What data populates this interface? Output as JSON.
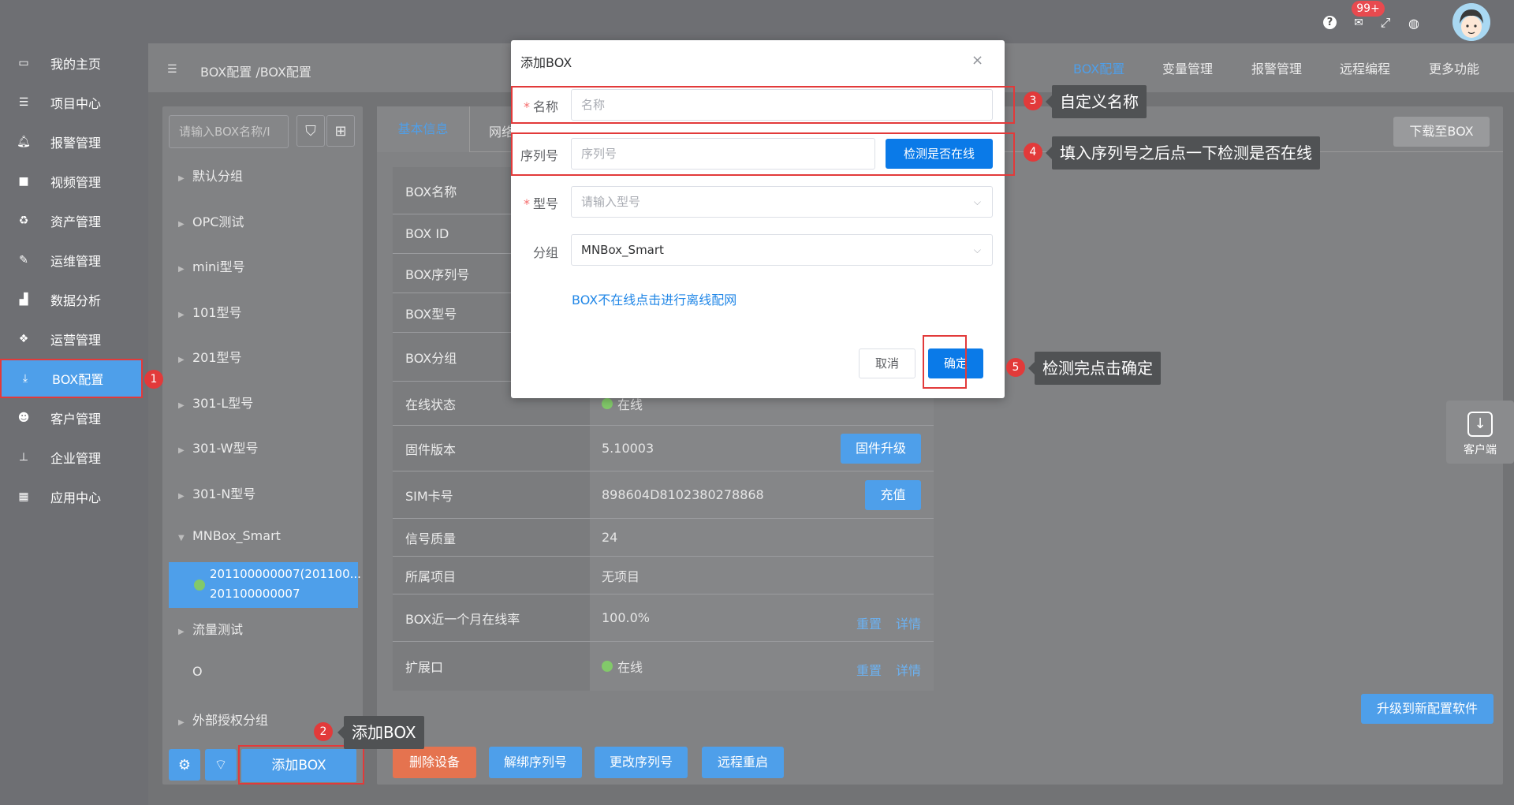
{
  "topbar": {
    "help": "?",
    "badge": "99+",
    "mail": "✉",
    "fullscreen": "⤢",
    "globe": "◍"
  },
  "sidebar": {
    "items": [
      {
        "label": "我的主页",
        "icon": "laptop-icon"
      },
      {
        "label": "项目中心",
        "icon": "list-icon"
      },
      {
        "label": "报警管理",
        "icon": "bell-icon"
      },
      {
        "label": "视频管理",
        "icon": "video-icon"
      },
      {
        "label": "资产管理",
        "icon": "recycle-icon"
      },
      {
        "label": "运维管理",
        "icon": "wrench-icon"
      },
      {
        "label": "数据分析",
        "icon": "chart-icon"
      },
      {
        "label": "运营管理",
        "icon": "cubes-icon"
      },
      {
        "label": "BOX配置",
        "icon": "download-icon"
      },
      {
        "label": "客户管理",
        "icon": "users-icon"
      },
      {
        "label": "企业管理",
        "icon": "sitemap-icon"
      },
      {
        "label": "应用中心",
        "icon": "grid-icon"
      }
    ]
  },
  "header": {
    "breadcrumb": "BOX配置 /BOX配置",
    "menu": [
      "BOX配置",
      "变量管理",
      "报警管理",
      "远程编程",
      "更多功能"
    ]
  },
  "left": {
    "search_placeholder": "请输入BOX名称/I",
    "groups": [
      "默认分组",
      "OPC测试",
      "mini型号",
      "101型号",
      "201型号",
      "301-L型号",
      "301-W型号",
      "301-N型号",
      "MNBox_Smart",
      "流量测试",
      "O",
      "外部授权分组"
    ],
    "selected": {
      "line1": "201100000007(201100...",
      "line2": "201100000007"
    },
    "add_button": "添加BOX"
  },
  "tabs": {
    "basic": "基本信息",
    "network": "网络",
    "download": "下载至BOX"
  },
  "info": {
    "rows": [
      {
        "label": "BOX名称",
        "value": ""
      },
      {
        "label": "BOX ID",
        "value": ""
      },
      {
        "label": "BOX序列号",
        "value": ""
      },
      {
        "label": "BOX型号",
        "value": ""
      },
      {
        "label": "BOX分组",
        "value": ""
      },
      {
        "label": "在线状态",
        "value": "在线"
      },
      {
        "label": "固件版本",
        "value": "5.10003"
      },
      {
        "label": "SIM卡号",
        "value": "898604D8102380278868"
      },
      {
        "label": "信号质量",
        "value": "24"
      },
      {
        "label": "所属项目",
        "value": "无项目"
      },
      {
        "label": "BOX近一个月在线率",
        "value": "100.0%"
      },
      {
        "label": "扩展口",
        "value": "在线"
      }
    ],
    "firmware_btn": "固件升级",
    "recharge_btn": "充值",
    "reset": "重置",
    "detail": "详情"
  },
  "actions": [
    "删除设备",
    "解绑序列号",
    "更改序列号",
    "远程重启"
  ],
  "upgrade_btn": "升级到新配置软件",
  "client_label": "客户端",
  "modal": {
    "title": "添加BOX",
    "close": "×",
    "name_label": "名称",
    "name_placeholder": "名称",
    "serial_label": "序列号",
    "serial_placeholder": "序列号",
    "check_btn": "检测是否在线",
    "model_label": "型号",
    "model_placeholder": "请输入型号",
    "group_label": "分组",
    "group_value": "MNBox_Smart",
    "offline_link": "BOX不在线点击进行离线配网",
    "cancel": "取消",
    "ok": "确定"
  },
  "annotations": [
    {
      "n": "1",
      "text": ""
    },
    {
      "n": "2",
      "text": "添加BOX"
    },
    {
      "n": "3",
      "text": "自定义名称"
    },
    {
      "n": "4",
      "text": "填入序列号之后点一下检测是否在线"
    },
    {
      "n": "5",
      "text": "检测完点击确定"
    }
  ]
}
